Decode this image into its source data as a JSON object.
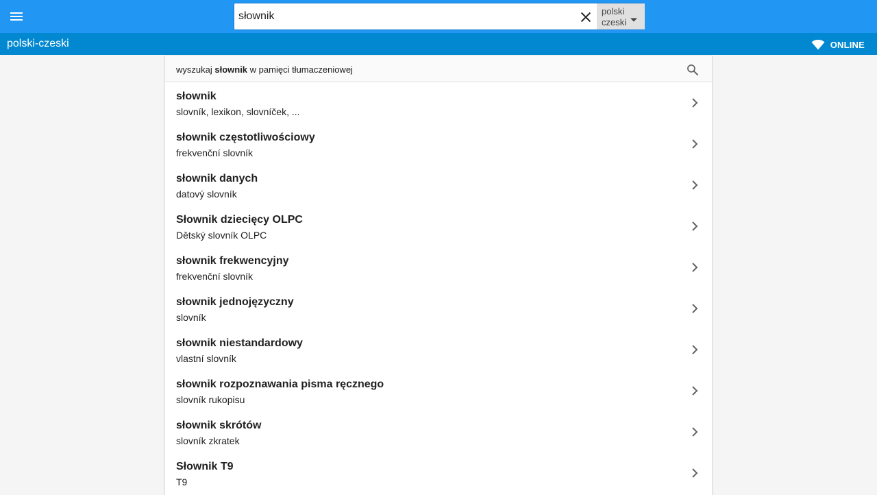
{
  "header": {
    "search": {
      "value": "słownik",
      "placeholder": ""
    },
    "language_select": {
      "line1": "polski",
      "line2": "czeski"
    }
  },
  "subbar": {
    "pair_title": "polski-czeski",
    "status_label": "ONLINE"
  },
  "tm_search": {
    "prefix": "wyszukaj ",
    "term": "słownik",
    "suffix": " w pamięci tłumaczeniowej"
  },
  "results": [
    {
      "title": "słownik",
      "translation": "slovník, lexikon, slovníček, ..."
    },
    {
      "title": "słownik częstotliwościowy",
      "translation": "frekvenční slovník"
    },
    {
      "title": "słownik danych",
      "translation": "datový slovník"
    },
    {
      "title": "Słownik dziecięcy OLPC",
      "translation": "Dětský slovník OLPC"
    },
    {
      "title": "słownik frekwencyjny",
      "translation": "frekvenční slovník"
    },
    {
      "title": "słownik jednojęzyczny",
      "translation": "slovník"
    },
    {
      "title": "słownik niestandardowy",
      "translation": "vlastní slovník"
    },
    {
      "title": "słownik rozpoznawania pisma ręcznego",
      "translation": "slovník rukopisu"
    },
    {
      "title": "słownik skrótów",
      "translation": "slovník zkratek"
    },
    {
      "title": "Słownik T9",
      "translation": "T9"
    }
  ],
  "icons": {
    "menu": "hamburger-menu-icon",
    "clear": "close-icon",
    "dropdown": "caret-down-icon",
    "status": "wifi-icon",
    "tm_search": "search-icon",
    "row": "chevron-right-icon"
  },
  "colors": {
    "primary": "#2196f3",
    "primary_dark": "#0288d1",
    "background": "#f5f5f5",
    "text": "#212121"
  }
}
